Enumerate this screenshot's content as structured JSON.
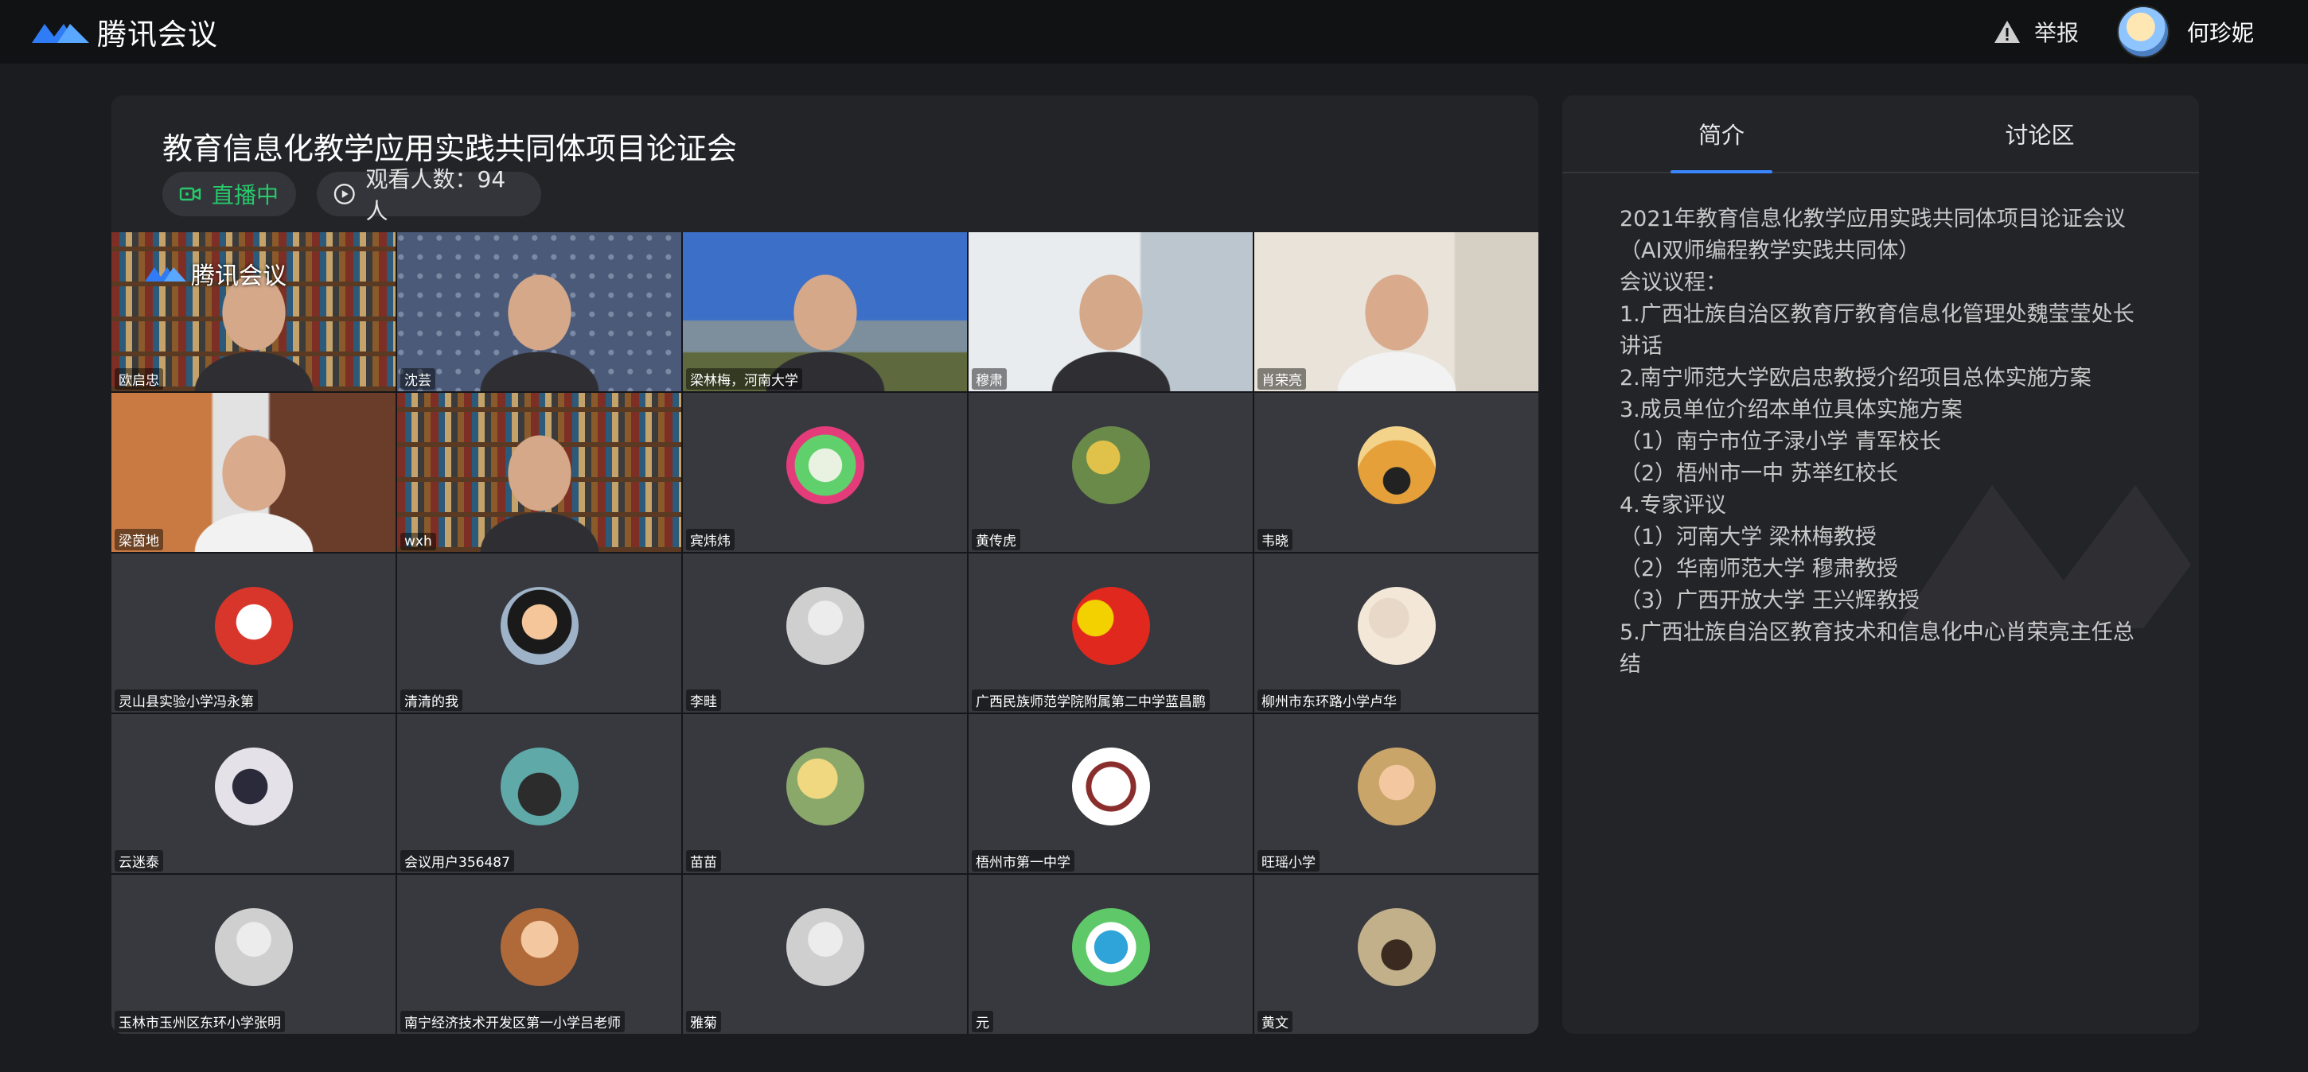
{
  "app": {
    "title": "腾讯会议"
  },
  "topbar": {
    "report_label": "举报",
    "user_name": "何珍妮"
  },
  "meeting": {
    "title": "教育信息化教学应用实践共同体项目论证会",
    "live_label": "直播中",
    "viewers_label": "观看人数：94人"
  },
  "participants": [
    {
      "name": "欧启忠",
      "kind": "video"
    },
    {
      "name": "沈芸",
      "kind": "video"
    },
    {
      "name": "梁林梅，河南大学",
      "kind": "video"
    },
    {
      "name": "穆肃",
      "kind": "video"
    },
    {
      "name": "肖荣亮",
      "kind": "video"
    },
    {
      "name": "梁茵地",
      "kind": "video"
    },
    {
      "name": "wxh",
      "kind": "video"
    },
    {
      "name": "宾炜炜",
      "kind": "avatar"
    },
    {
      "name": "黄传虎",
      "kind": "avatar"
    },
    {
      "name": "韦晓",
      "kind": "avatar"
    },
    {
      "name": "灵山县实验小学冯永第",
      "kind": "avatar"
    },
    {
      "name": "清清的我",
      "kind": "avatar"
    },
    {
      "name": "李畦",
      "kind": "avatar"
    },
    {
      "name": "广西民族师范学院附属第二中学蓝昌鹏",
      "kind": "avatar"
    },
    {
      "name": "柳州市东环路小学卢华",
      "kind": "avatar"
    },
    {
      "name": "云迷泰",
      "kind": "avatar"
    },
    {
      "name": "会议用户356487",
      "kind": "avatar"
    },
    {
      "name": "苗苗",
      "kind": "avatar"
    },
    {
      "name": "梧州市第一中学",
      "kind": "avatar"
    },
    {
      "name": "旺瑶小学",
      "kind": "avatar"
    },
    {
      "name": "玉林市玉州区东环小学张明",
      "kind": "avatar"
    },
    {
      "name": "南宁经济技术开发区第一小学吕老师",
      "kind": "avatar"
    },
    {
      "name": "雅菊",
      "kind": "avatar"
    },
    {
      "name": "元",
      "kind": "avatar"
    },
    {
      "name": "黄文",
      "kind": "avatar"
    }
  ],
  "tile_overlay_logo": "腾讯会议",
  "side_panel": {
    "tabs": [
      {
        "label": "简介",
        "active": true
      },
      {
        "label": "讨论区",
        "active": false
      }
    ],
    "intro_lines": [
      "2021年教育信息化教学应用实践共同体项目论证会议（AI双师编程教学实践共同体）",
      "会议议程：",
      "1.广西壮族自治区教育厅教育信息化管理处魏莹莹处长 讲话",
      "2.南宁师范大学欧启忠教授介绍项目总体实施方案",
      "3.成员单位介绍本单位具体实施方案",
      "（1）南宁市位子渌小学 青军校长",
      "（2）梧州市一中 苏举红校长",
      "4.专家评议",
      "（1）河南大学 梁林梅教授",
      "（2）华南师范大学 穆肃教授",
      "（3）广西开放大学 王兴辉教授",
      "5.广西壮族自治区教育技术和信息化中心肖荣亮主任总结"
    ]
  },
  "colors": {
    "accent_blue": "#3a86ff",
    "live_green": "#27c96a",
    "panel_bg": "#232428",
    "page_bg": "#1b1c1f",
    "topbar_bg": "#111214"
  }
}
